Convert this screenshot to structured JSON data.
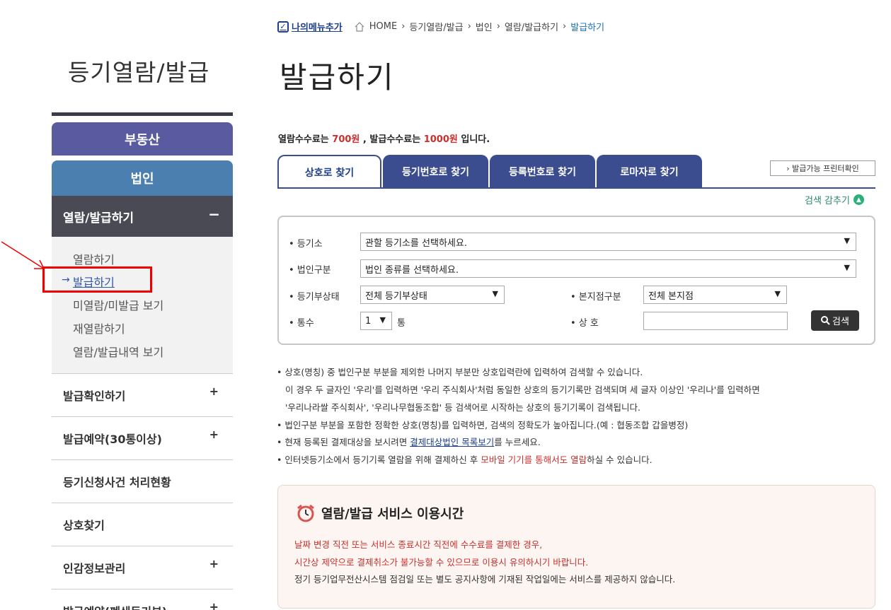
{
  "left": {
    "title": "등기열람/발급",
    "categories": [
      "부동산",
      "법인"
    ],
    "active_section": "열람/발급하기",
    "active_toggle": "−",
    "submenu": [
      "열람하기",
      "발급하기",
      "미열람/미발급 보기",
      "재열람하기",
      "열람/발급내역 보기"
    ],
    "submenu_active_marker": "→",
    "rows": [
      {
        "label": "발급확인하기",
        "toggle": "+"
      },
      {
        "label": "발급예약(30통이상)",
        "toggle": "+"
      },
      {
        "label": "등기신청사건 처리현황",
        "toggle": ""
      },
      {
        "label": "상호찾기",
        "toggle": ""
      },
      {
        "label": "인감정보관리",
        "toggle": "+"
      },
      {
        "label": "발급예약(폐쇄등기부)",
        "toggle": "+"
      }
    ]
  },
  "breadcrumb": {
    "mymenu": "나의메뉴추가",
    "path": [
      "HOME",
      "등기열람/발급",
      "법인",
      "열람/발급하기"
    ],
    "current": "발급하기",
    "separator": "›"
  },
  "page_title": "발급하기",
  "fee": {
    "prefix": "열람수수료는 ",
    "view_fee": "700원",
    "mid": " , 발급수수료는 ",
    "issue_fee": "1000원",
    "suffix": " 입니다."
  },
  "tabs": [
    "상호로 찾기",
    "등기번호로 찾기",
    "등록번호로 찾기",
    "로마자로 찾기"
  ],
  "printer_button": "› 발급가능 프린터확인",
  "collapse_link": "검색 감추기",
  "form": {
    "registry_label": "• 등기소",
    "registry_value": "관할 등기소를 선택하세요.",
    "corp_type_label": "• 법인구분",
    "corp_type_value": "법인 종류를 선택하세요.",
    "status_label": "• 등기부상태",
    "status_value": "전체 등기부상태",
    "branch_label": "• 본지점구분",
    "branch_value": "전체 본지점",
    "copies_label": "• 통수",
    "copies_value": "1",
    "copies_unit": "통",
    "name_label": "• 상 호",
    "name_value": "",
    "search_button": "검색",
    "caret": "▼"
  },
  "notes": {
    "line1": "• 상호(명칭) 중 법인구분 부분을 제외한 나머지 부분만 상호입력란에 입력하여 검색할 수 있습니다.",
    "line2": "이 경우 두 글자인 '우리'를 입력하면 '우리 주식회사'처럼 동일한 상호의 등기기록만 검색되며 세 글자 이상인 '우리나'를 입력하면",
    "line3": "'우리나라쌀 주식회사', '우리나무협동조합' 등 검색어로 시작하는 상호의 등기기록이 검색됩니다.",
    "line4": "• 법인구분 부분을 포함한 정확한 상호(명칭)를 입력하면, 검색의 정확도가 높아집니다.(예 : 협동조합 갑을병정)",
    "line5_prefix": "• 현재 등록된 결제대상을 보시려면 ",
    "line5_link": "결제대상법인 목록보기",
    "line5_suffix": "를 누르세요.",
    "line6_prefix": "• 인터넷등기소에서 등기기록 열람을 위해 결제하신 후 ",
    "line6_red": "모바일 기기를 통해서도 열람",
    "line6_suffix": "하실 수 있습니다."
  },
  "service_time": {
    "title": "열람/발급 서비스 이용시간",
    "line1": "날짜 변경 직전 또는 서비스 종료시간 직전에 수수료를 결제한 경우,",
    "line2": "시간상 제약으로 결제취소가 불가능할 수 있으므로 이용시 유의하시기 바랍니다.",
    "line3": "정기 등기업무전산시스템 점검일 또는 별도 공지사항에 기재된 작업일에는 서비스를 제공하지 않습니다."
  },
  "icons": [
    "check-icon",
    "home-icon",
    "search-icon",
    "chevron-up-icon",
    "alarm-clock-icon",
    "pointer-arrow-icon"
  ],
  "colors": {
    "navy": "#3b4c8f",
    "purple": "#5a5aa0",
    "blue": "#4a7fb0",
    "red": "#c9302c",
    "highlight": "#ee0000"
  }
}
